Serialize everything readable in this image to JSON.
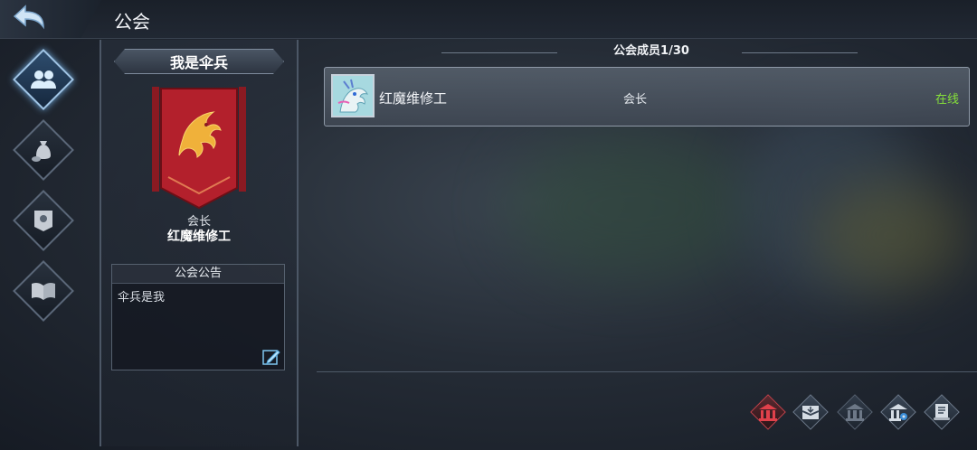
{
  "header": {
    "title": "公会"
  },
  "guild": {
    "name": "我是伞兵",
    "leader_role": "会长",
    "leader_name": "红魔维修工",
    "notice_title": "公会公告",
    "notice_text": "伞兵是我"
  },
  "members": {
    "header": "公会成员1/30",
    "list": [
      {
        "name": "红魔维修工",
        "role": "会长",
        "status": "在线"
      }
    ]
  },
  "icons": {
    "back": "back-arrow-icon",
    "rail": [
      "members-icon",
      "treasury-bag-icon",
      "guild-flag-icon",
      "book-icon"
    ],
    "actions": [
      "guild-hall-red-icon",
      "mail-icon",
      "guild-building-icon",
      "guild-settings-icon",
      "scroll-icon"
    ]
  },
  "colors": {
    "online": "#86e13a",
    "accent": "#9fc3e4",
    "banner": "#b3202c"
  }
}
